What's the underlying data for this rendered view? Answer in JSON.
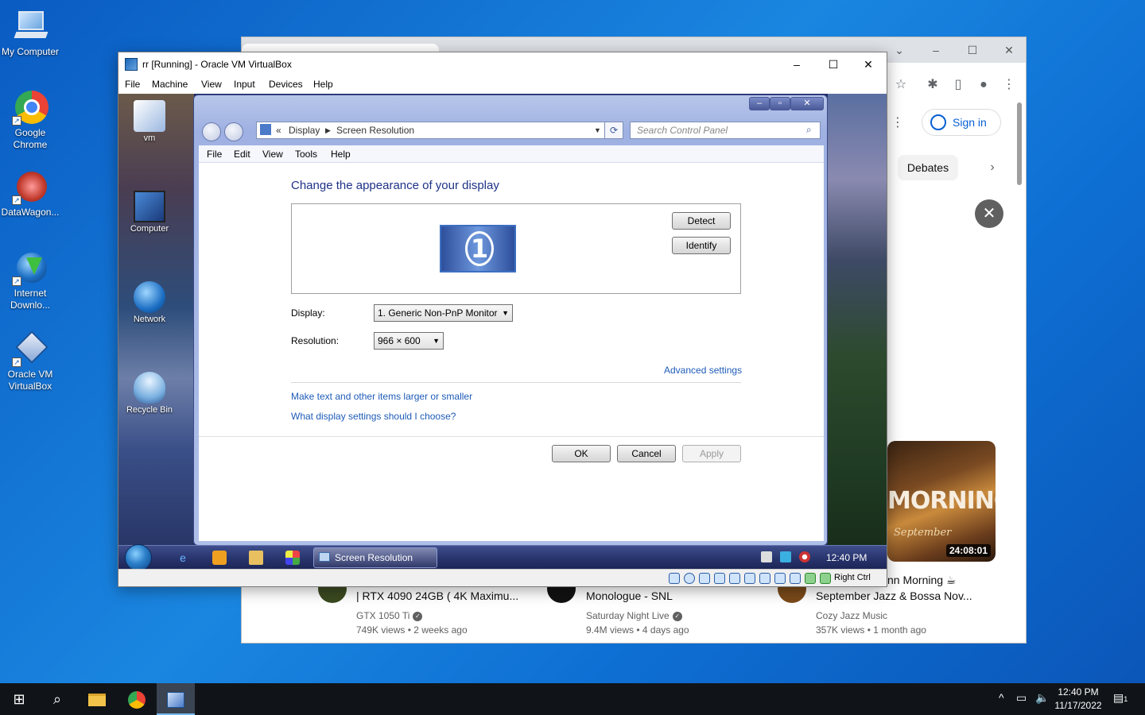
{
  "desktop": {
    "icons": [
      {
        "label": "My Computer",
        "icon": "computer-icon"
      },
      {
        "label": "Google Chrome",
        "icon": "chrome-icon"
      },
      {
        "label": "DataWagon...",
        "icon": "datawagon-icon"
      },
      {
        "label": "Internet Downlo...",
        "icon": "idm-icon"
      },
      {
        "label": "Oracle VM VirtualBox",
        "icon": "virtualbox-icon"
      }
    ]
  },
  "chrome": {
    "sign_in": "Sign in",
    "chip": "Debates",
    "thumbnail": {
      "title": "MORNING",
      "subtitle": "September",
      "duration": "24:08:01"
    },
    "videos": [
      {
        "title": "| RTX 4090 24GB ( 4K Maximu...",
        "channel": "GTX 1050 Ti",
        "meta": "749K views • 2 weeks ago"
      },
      {
        "title": "Monologue - SNL",
        "channel": "Saturday Night Live",
        "meta": "9.4M views • 4 days ago"
      },
      {
        "title_top": "nn Morning ☕",
        "title": "September Jazz & Bossa Nov...",
        "channel": "Cozy Jazz Music",
        "meta": "357K views • 1 month ago"
      }
    ]
  },
  "vbox": {
    "title": "rr [Running] - Oracle VM VirtualBox",
    "menu": [
      "File",
      "Machine",
      "View",
      "Input",
      "Devices",
      "Help"
    ],
    "status_host_key": "Right Ctrl"
  },
  "guest": {
    "icons": [
      {
        "label": "vm"
      },
      {
        "label": "Computer"
      },
      {
        "label": "Network"
      },
      {
        "label": "Recycle Bin"
      }
    ],
    "taskbar": {
      "task_label": "Screen Resolution",
      "clock": "12:40 PM"
    }
  },
  "dialog": {
    "breadcrumb": {
      "prefix": "«",
      "item1": "Display",
      "item2": "Screen Resolution"
    },
    "search_placeholder": "Search Control Panel",
    "menu": [
      "File",
      "Edit",
      "View",
      "Tools",
      "Help"
    ],
    "heading": "Change the appearance of your display",
    "monitor_number": "1",
    "detect": "Detect",
    "identify": "Identify",
    "display_label": "Display:",
    "display_value": "1. Generic Non-PnP Monitor",
    "resolution_label": "Resolution:",
    "resolution_value": "966 × 600",
    "advanced": "Advanced settings",
    "link1": "Make text and other items larger or smaller",
    "link2": "What display settings should I choose?",
    "ok": "OK",
    "cancel": "Cancel",
    "apply": "Apply"
  },
  "taskbar": {
    "time": "12:40 PM",
    "date": "11/17/2022",
    "notification_count": "1"
  }
}
